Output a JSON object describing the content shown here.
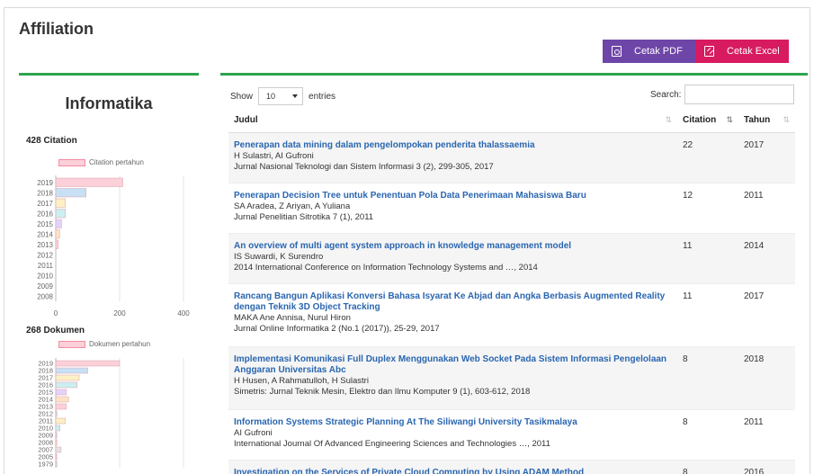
{
  "page": {
    "title": "Affiliation"
  },
  "toolbar": {
    "pdf_label": "Cetak PDF",
    "excel_label": "Cetak Excel"
  },
  "sidebar": {
    "unit_name": "Informatika",
    "citation_label": "428 Citation",
    "citation_legend": "Citation pertahun",
    "dokumen_label": "268 Dokumen",
    "dokumen_legend": "Dokumen pertahun"
  },
  "chart_data": [
    {
      "type": "bar",
      "orientation": "horizontal",
      "title": "428 Citation",
      "series": [
        {
          "name": "Citation pertahun"
        }
      ],
      "categories": [
        "2019",
        "2018",
        "2017",
        "2016",
        "2015",
        "2014",
        "2013",
        "2012",
        "2011",
        "2010",
        "2009",
        "2008"
      ],
      "values": [
        210,
        95,
        30,
        30,
        18,
        12,
        8,
        0,
        0,
        0,
        0,
        0
      ],
      "colors": [
        "#fbd0d9",
        "#c8e0f4",
        "#fdf0c4",
        "#cbeff0",
        "#e3d3fb",
        "#fde2c4",
        "#fbd0d9",
        "#c8e0f4",
        "#fdf0c4",
        "#cbeff0",
        "#e3d3fb",
        "#fde2c4"
      ],
      "xticks": [
        "0",
        "200",
        "400"
      ],
      "xlim": [
        0,
        400
      ]
    },
    {
      "type": "bar",
      "orientation": "horizontal",
      "title": "268 Dokumen",
      "series": [
        {
          "name": "Dokumen pertahun"
        }
      ],
      "categories": [
        "2019",
        "2018",
        "2017",
        "2016",
        "2015",
        "2014",
        "2013",
        "2012",
        "2011",
        "2010",
        "2009",
        "2008",
        "2007",
        "2005",
        "1979"
      ],
      "values": [
        60,
        30,
        22,
        20,
        10,
        12,
        10,
        1,
        9,
        4,
        1,
        1,
        5,
        1,
        1
      ],
      "colors": [
        "#fbd0d9",
        "#c8e0f4",
        "#fdf0c4",
        "#cbeff0",
        "#e3d3fb",
        "#fde2c4",
        "#fbd0d9",
        "#c8e0f4",
        "#fdf0c4",
        "#cbeff0",
        "#e3d3fb",
        "#fde2c4",
        "#e5e5e5",
        "#fbd0d9",
        "#c8e0f4"
      ],
      "xlim": [
        0,
        120
      ]
    }
  ],
  "table": {
    "show_label": "Show",
    "entries_value": "10",
    "entries_label": "entries",
    "search_label": "Search:",
    "search_value": "",
    "headers": {
      "judul": "Judul",
      "citation": "Citation",
      "tahun": "Tahun"
    },
    "rows": [
      {
        "title": "Penerapan data mining dalam pengelompokan penderita thalassaemia",
        "authors": "H Sulastri, AI Gufroni",
        "venue": "Jurnal Nasional Teknologi dan Sistem Informasi 3 (2), 299-305, 2017",
        "citation": "22",
        "year": "2017"
      },
      {
        "title": "Penerapan Decision Tree untuk Penentuan Pola Data Penerimaan Mahasiswa Baru",
        "authors": "SA Aradea, Z Ariyan, A Yuliana",
        "venue": "Jurnal Penelitian Sitrotika 7 (1), 2011",
        "citation": "12",
        "year": "2011"
      },
      {
        "title": "An overview of multi agent system approach in knowledge management model",
        "authors": "IS Suwardi, K Surendro",
        "venue": "2014 International Conference on Information Technology Systems and …, 2014",
        "citation": "11",
        "year": "2014"
      },
      {
        "title": "Rancang Bangun Aplikasi Konversi Bahasa Isyarat Ke Abjad dan Angka Berbasis Augmented Reality dengan Teknik 3D Object Tracking",
        "authors": "MAKA Ane Annisa, Nurul Hiron",
        "venue": "Jurnal Online Informatika 2 (No.1 (2017)), 25-29, 2017",
        "citation": "11",
        "year": "2017"
      },
      {
        "title": "Implementasi Komunikasi Full Duplex Menggunakan Web Socket Pada Sistem Informasi Pengelolaan Anggaran Universitas Abc",
        "authors": "H Husen, A Rahmatulloh, H Sulastri",
        "venue": "Simetris: Jurnal Teknik Mesin, Elektro dan Ilmu Komputer 9 (1), 603-612, 2018",
        "citation": "8",
        "year": "2018"
      },
      {
        "title": "Information Systems Strategic Planning At The Siliwangi University Tasikmalaya",
        "authors": "AI Gufroni",
        "venue": "International Journal Of Advanced Engineering Sciences and Technologies …, 2011",
        "citation": "8",
        "year": "2011"
      },
      {
        "title": "Investigation on the Services of Private Cloud Computing by Using ADAM Method",
        "authors": "",
        "venue": "",
        "citation": "8",
        "year": "2016"
      }
    ]
  }
}
